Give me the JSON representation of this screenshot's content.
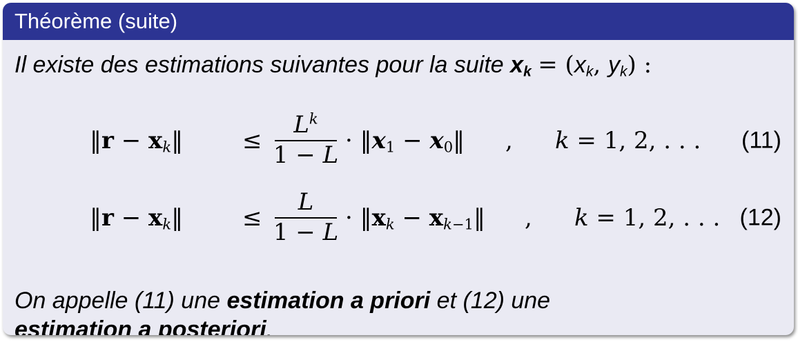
{
  "block": {
    "title": "Théorème (suite)"
  },
  "intro": {
    "text": "Il existe des estimations suivantes pour la suite",
    "var": "x",
    "sub": "k",
    "eq": "= (",
    "x": "x",
    "y": "y",
    "tail": ") :"
  },
  "equations": [
    {
      "lhs_open": "‖r − x",
      "lhs_sub": "k",
      "lhs_close": "‖",
      "relation": "≤",
      "num_base": "L",
      "num_sup": "k",
      "den": "1 − L",
      "rhs": "· ‖x₁ − x₀‖",
      "separator": ",",
      "condition": "k = 1, 2, . . .",
      "number": "(11)"
    },
    {
      "lhs_open": "‖r − x",
      "lhs_sub": "k",
      "lhs_close": "‖",
      "relation": "≤",
      "num_base": "L",
      "num_sup": "",
      "den": "1 − L",
      "rhs": "· ‖xₖ − xₖ₋₁‖",
      "separator": ",",
      "condition": "k = 1, 2, . . .",
      "number": "(12)"
    }
  ],
  "closing": {
    "t1": "On appelle (11) une",
    "b1": "estimation a priori",
    "t2": "et (12) une",
    "b2": "estimation a posteriori",
    "end": "."
  }
}
